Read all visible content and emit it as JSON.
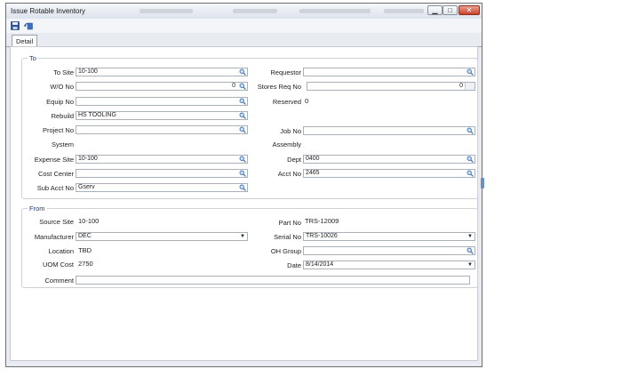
{
  "window": {
    "title": "Issue Rotable Inventory"
  },
  "tabs": [
    {
      "label": "Detail"
    }
  ],
  "icons": {
    "save": "save-icon",
    "undo": "undo-icon",
    "lookup": "magnifier-icon"
  },
  "to": {
    "legend": "To",
    "to_site": {
      "label": "To Site",
      "value": "10-100"
    },
    "wo_no": {
      "label": "W/O No",
      "value": "0"
    },
    "equip_no": {
      "label": "Equip No",
      "value": ""
    },
    "rebuild": {
      "label": "Rebuild",
      "value": "HS TOOLING"
    },
    "project_no": {
      "label": "Project No",
      "value": ""
    },
    "system": {
      "label": "System",
      "value": ""
    },
    "expense_site": {
      "label": "Expense Site",
      "value": "10-100"
    },
    "cost_center": {
      "label": "Cost Center",
      "value": ""
    },
    "sub_acct_no": {
      "label": "Sub Acct No",
      "value": "Gserv"
    },
    "requestor": {
      "label": "Requestor",
      "value": ""
    },
    "stores_req_no": {
      "label": "Stores Req No",
      "value": "0"
    },
    "reserved": {
      "label": "Reserved",
      "value": "0"
    },
    "job_no": {
      "label": "Job No",
      "value": ""
    },
    "assembly": {
      "label": "Assembly",
      "value": ""
    },
    "dept": {
      "label": "Dept",
      "value": "0400"
    },
    "acct_no": {
      "label": "Acct No",
      "value": "2465"
    }
  },
  "from": {
    "legend": "From",
    "source_site": {
      "label": "Source Site",
      "value": "10-100"
    },
    "manufacturer": {
      "label": "Manufacturer",
      "value": "DEC"
    },
    "location": {
      "label": "Location",
      "value": "TBD"
    },
    "uom_cost": {
      "label": "UOM Cost",
      "value": "2750"
    },
    "part_no": {
      "label": "Part No",
      "value": "TRS-12009"
    },
    "serial_no": {
      "label": "Serial No",
      "value": "TRS-10026"
    },
    "oh_group": {
      "label": "OH Group",
      "value": ""
    },
    "date": {
      "label": "Date",
      "value": "8/14/2014"
    },
    "comment": {
      "label": "Comment",
      "value": ""
    }
  }
}
